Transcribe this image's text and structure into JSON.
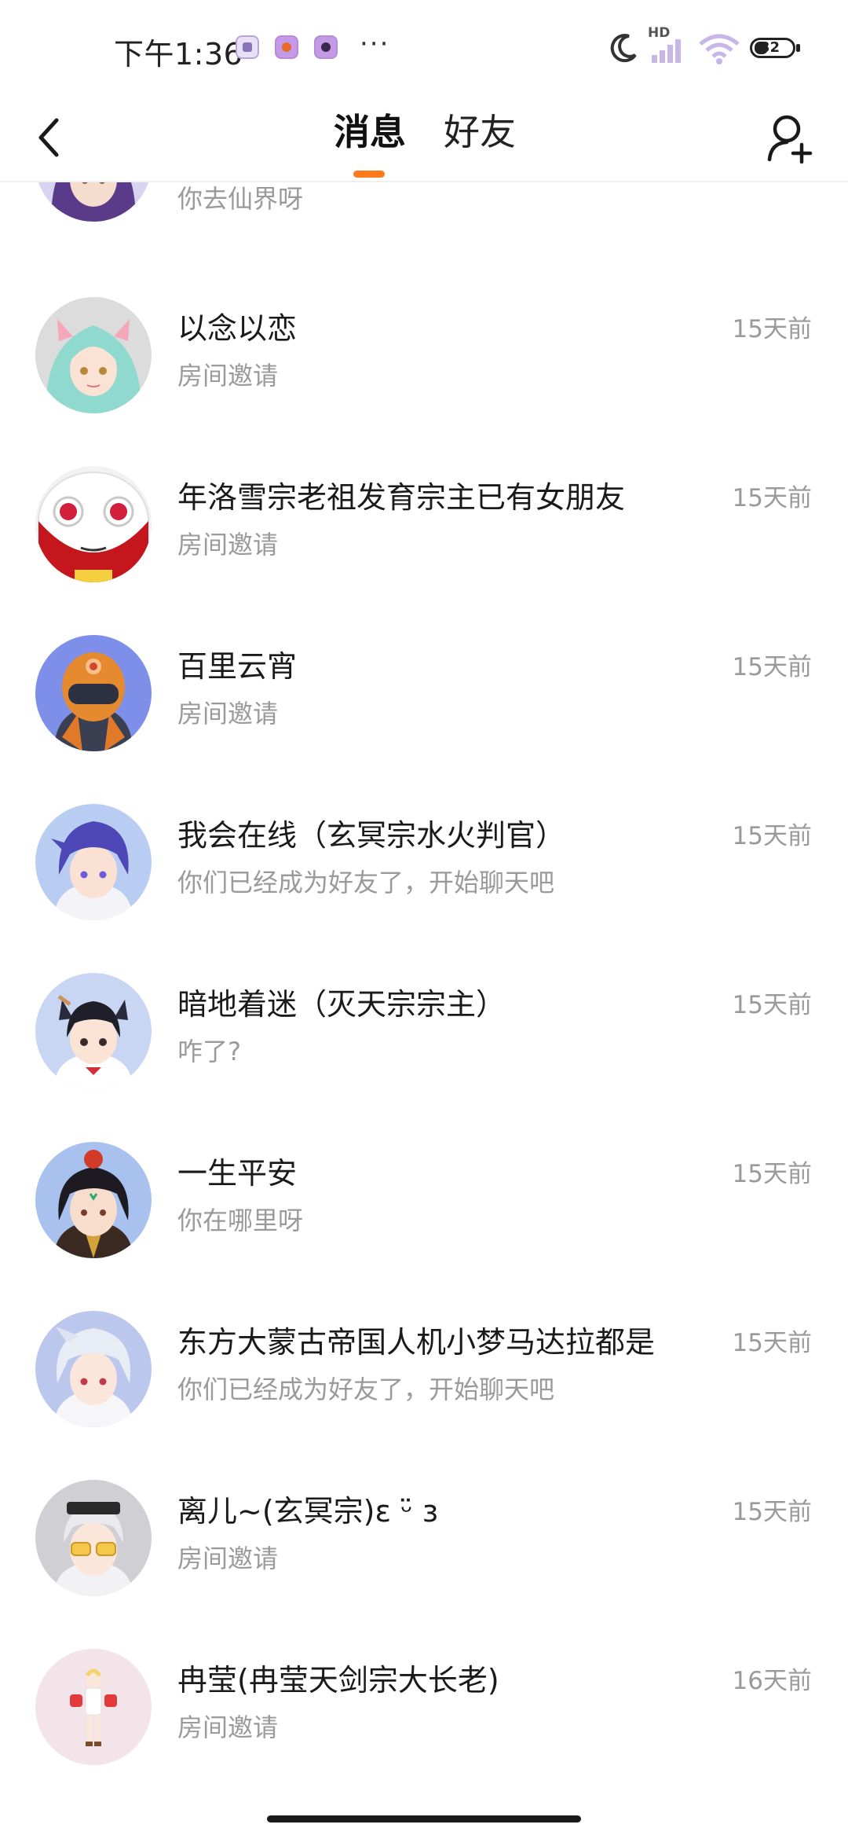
{
  "status_bar": {
    "time": "下午1:36",
    "dots": "···",
    "network_label": "HD",
    "battery_level": "32",
    "icons": [
      "wechat-notification-icon",
      "app-notification-icon",
      "tiktok-notification-icon",
      "moon-icon",
      "signal-icon",
      "wifi-icon",
      "battery-icon"
    ]
  },
  "nav": {
    "tab_messages": "消息",
    "tab_friends": "好友",
    "active_tab": "消息",
    "accent_color": "#ff7a1a",
    "back_icon": "chevron-left-icon",
    "add_friend_icon": "add-user-icon"
  },
  "conversations": [
    {
      "name": "",
      "preview": "你去仙界呀",
      "time": "",
      "avatar": "purple-hair-girl"
    },
    {
      "name": "以念以恋",
      "preview": "房间邀请",
      "time": "15天前",
      "avatar": "teal-hair-cat-ears-girl"
    },
    {
      "name": "年洛雪宗老祖发育宗主已有女朋友",
      "preview": "房间邀请",
      "time": "15天前",
      "avatar": "white-mascot-red-eyes"
    },
    {
      "name": "百里云宵",
      "preview": "房间邀请",
      "time": "15天前",
      "avatar": "orange-robot"
    },
    {
      "name": "我会在线（玄冥宗水火判官）",
      "preview": "你们已经成为好友了，开始聊天吧",
      "time": "15天前",
      "avatar": "purple-hair-boy"
    },
    {
      "name": "暗地着迷（灭天宗宗主）",
      "preview": "咋了?",
      "time": "15天前",
      "avatar": "black-hair-cat-ears-girl"
    },
    {
      "name": "一生平安",
      "preview": "你在哪里呀",
      "time": "15天前",
      "avatar": "black-hair-boy-red-hat"
    },
    {
      "name": "东方大蒙古帝国人机小梦马达拉都是",
      "preview": "你们已经成为好友了，开始聊天吧",
      "time": "15天前",
      "avatar": "white-hair-boy"
    },
    {
      "name": "离儿~(玄冥宗)ε ᵕ̈ з",
      "preview": "房间邀请",
      "time": "15天前",
      "avatar": "sunglasses-character"
    },
    {
      "name": "冉莹(冉莹天剑宗大长老)",
      "preview": "房间邀请",
      "time": "16天前",
      "avatar": "small-figure-pink"
    }
  ]
}
